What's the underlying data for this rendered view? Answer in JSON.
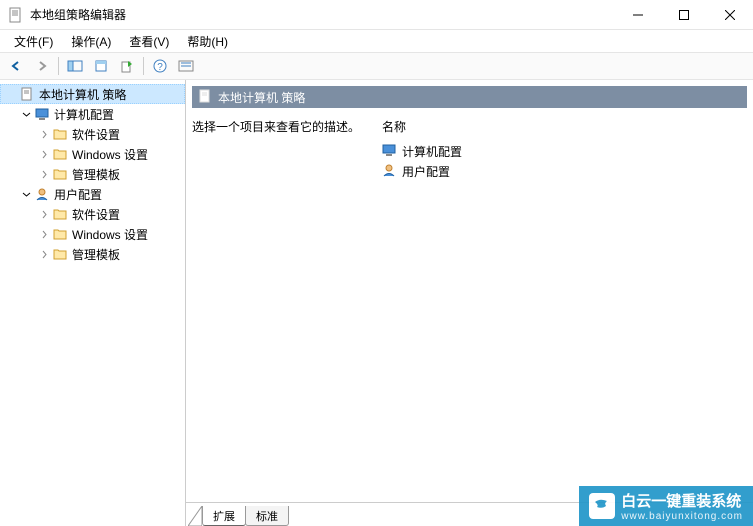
{
  "window": {
    "title": "本地组策略编辑器"
  },
  "menu": {
    "file": "文件(F)",
    "action": "操作(A)",
    "view": "查看(V)",
    "help": "帮助(H)"
  },
  "tree": {
    "root": "本地计算机 策略",
    "computer_config": "计算机配置",
    "user_config": "用户配置",
    "software_settings": "软件设置",
    "windows_settings": "Windows 设置",
    "admin_templates": "管理模板"
  },
  "detail": {
    "header": "本地计算机 策略",
    "description_prompt": "选择一个项目来查看它的描述。",
    "column_name": "名称",
    "items": {
      "computer_config": "计算机配置",
      "user_config": "用户配置"
    }
  },
  "tabs": {
    "extended": "扩展",
    "standard": "标准"
  },
  "watermark": {
    "brand": "白云一键重装系统",
    "url": "www.baiyunxitong.com"
  }
}
